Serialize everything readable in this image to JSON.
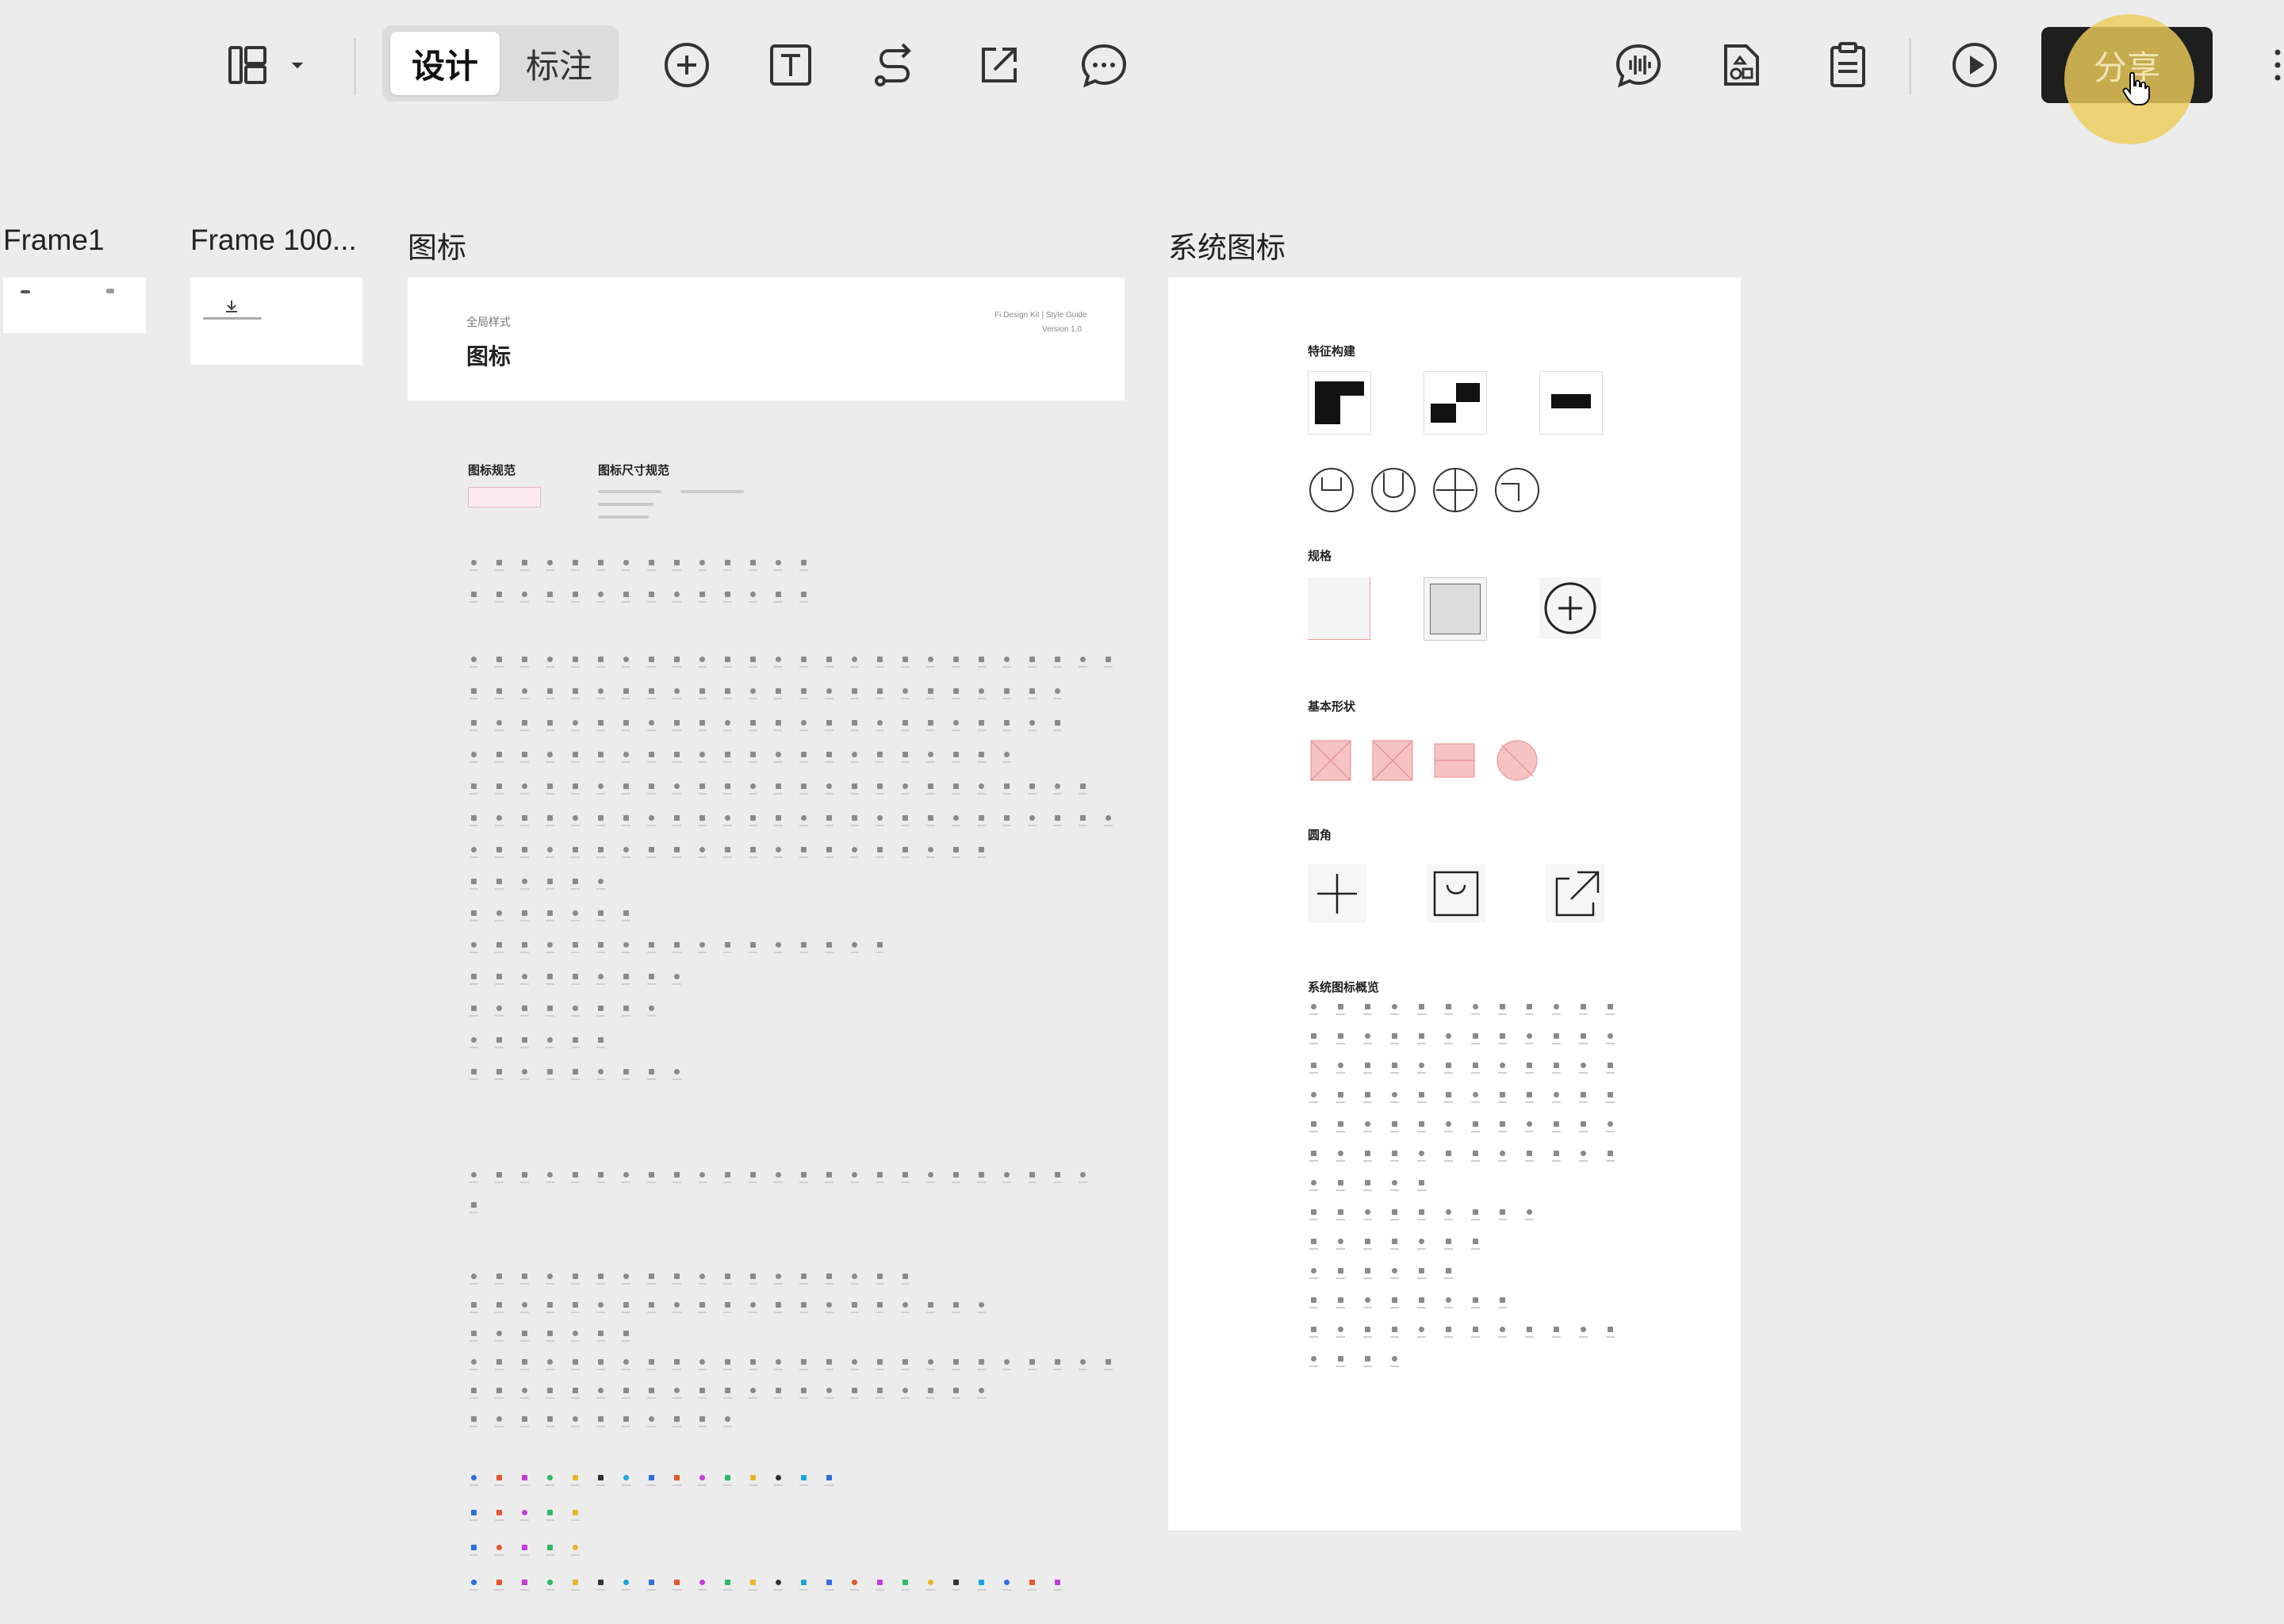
{
  "toolbar": {
    "mode_tabs": [
      {
        "label": "设计",
        "active": true
      },
      {
        "label": "标注",
        "active": false
      }
    ],
    "tool_icons": [
      "layout-panel-icon",
      "chevron-down-icon",
      "add-circle-icon",
      "text-tool-icon",
      "connector-icon",
      "export-icon",
      "comment-icon"
    ],
    "right_icons": [
      "voice-icon",
      "assets-icon",
      "clipboard-icon",
      "play-icon"
    ],
    "share_label": "分享"
  },
  "frames": [
    {
      "name": "Frame1"
    },
    {
      "name": "Frame 100..."
    },
    {
      "name": "图标"
    },
    {
      "name": "系统图标"
    }
  ],
  "icon_frame": {
    "header_subtitle": "全局样式",
    "header_title": "图标",
    "header_meta_line1": "Fi Design Kit | Style Guide",
    "header_meta_line2": "Version 1.0",
    "section_spec": "图标规范",
    "section_size": "图标尺寸规范"
  },
  "system_frame": {
    "sections": [
      "特征构建",
      "规格",
      "基本形状",
      "圆角",
      "系统图标概览"
    ]
  },
  "colors": {
    "background": "#ececec",
    "share_button": "#1e1e1e",
    "cursor_highlight": "#eccc5a",
    "guide_red": "#f4a6a6"
  }
}
